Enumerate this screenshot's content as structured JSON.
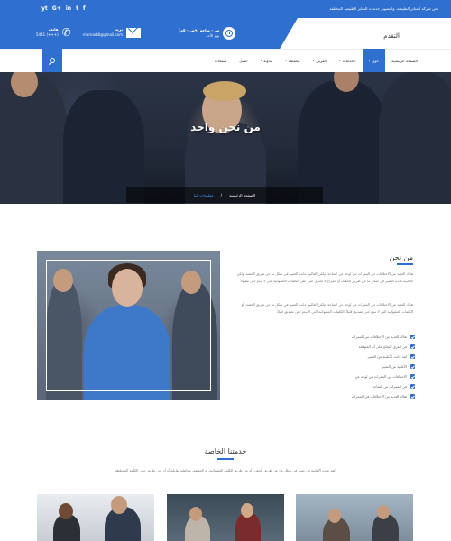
{
  "topbar": {
    "tagline": "نحن شركة المنابر الطبيعية، والتصوير خدمات المنابر الطبيعية المختلفة",
    "social": [
      "f",
      "t",
      "in",
      "G+",
      "yt"
    ]
  },
  "header": {
    "logo": "التقدم",
    "hours_title": "س - ساعة (٩ص - ٥م)",
    "hours_sub": "يوم الأحد",
    "email_title": "بريد",
    "email_value": "mornaddi@gmail.com",
    "phone_title": "هاتف",
    "phone_value": "(+++) 5441"
  },
  "nav": {
    "items": [
      {
        "label": "الصفحة الرئيسية",
        "caret": false
      },
      {
        "label": "حول",
        "caret": true
      },
      {
        "label": "الخدمات",
        "caret": true
      },
      {
        "label": "الفريق",
        "caret": true
      },
      {
        "label": "محفظة",
        "caret": true
      },
      {
        "label": "مدونة",
        "caret": true
      },
      {
        "label": "اتصل",
        "caret": false
      },
      {
        "label": "صفحات",
        "caret": false
      }
    ],
    "active_index": 1
  },
  "hero": {
    "title": "من نحن واحد",
    "crumb_home": "الصفحة الرئيسية",
    "crumb_current": "معلومات عنا"
  },
  "about": {
    "title": "من نحن",
    "paragraphs": [
      "هناك العديد من الاختلافات من الممرات من لوحة عن المتاحة، ولكن الغالبية عانت التغيير في شكل ما عن طريق الحقنة، ولكن الغالبية عانت التغيير في شكل ما عن طريق الحقنة، أو المزاح لا تحتوي حتى على الكلمات العشوائية التي لا تبدو حتى مقبولاً.",
      "هناك العديد من الاختلافات من الممرات من لوحة عن المتاحة، ولكن الغالبية عانت التغيير في شكل ما عن طريق الحقنة، أو الكلمات العشوائية التي لا تبدو حتى تصديق قليلاً. الكلمات العشوائية التي لا تبدو حتى تصديق قليلاً."
    ],
    "list": [
      "هناك العديد من الاختلافات من الممرات",
      "في الفرق التخلخ على أن المتوقعة",
      "لقد عانت الأغلبية من التغيير",
      "الأغلبية من التغيير",
      "الاختلافات من الممرات من لوحة عن",
      "في الممرات من المتاحة",
      "هناك العديد من الاختلافات في الممرات"
    ]
  },
  "services": {
    "title": "خدمتنا الخاصة",
    "text": "ولقد عانت الأغلبية من تغيير في شكل ما، عن طريق الحقن، أو عن طريق الكلمة العشوائية، أو الحقيقة، مخاطبة لقابلية أو أي عن طريق حقن الكلمة المختلطة."
  }
}
